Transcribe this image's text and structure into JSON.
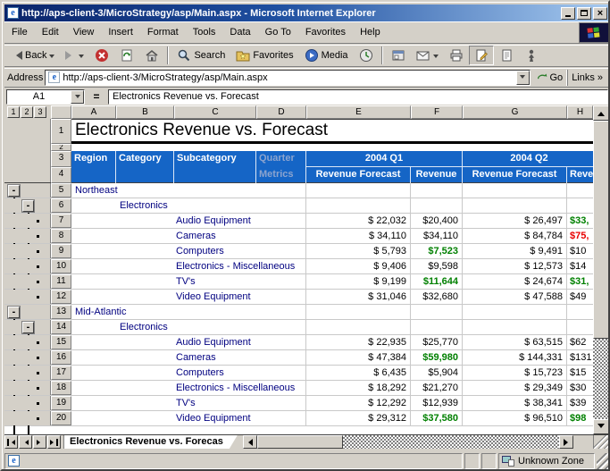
{
  "window": {
    "title": "http://aps-client-3/MicroStrategy/asp/Main.aspx - Microsoft Internet Explorer"
  },
  "menu_bar": {
    "items": [
      "File",
      "Edit",
      "View",
      "Insert",
      "Format",
      "Tools",
      "Data",
      "Go To",
      "Favorites",
      "Help"
    ]
  },
  "toolbar": {
    "back_label": "Back",
    "search_label": "Search",
    "favorites_label": "Favorites",
    "media_label": "Media"
  },
  "address_bar": {
    "label": "Address",
    "url": "http://aps-client-3/MicroStrategy/asp/Main.aspx",
    "go_label": "Go",
    "links_label": "Links",
    "links_chevron": "»"
  },
  "formula_bar": {
    "cell_ref": "A1",
    "equals_sign": "=",
    "value": "Electronics Revenue vs. Forecast"
  },
  "outline": {
    "level_buttons": [
      "1",
      "2",
      "3"
    ],
    "collapse_glyph": "-"
  },
  "grid": {
    "column_letters": [
      "A",
      "B",
      "C",
      "D",
      "E",
      "F",
      "G",
      "H"
    ],
    "row1": {
      "num": "1",
      "title": "Electronics Revenue vs. Forecast"
    },
    "row2_num": "2",
    "header": {
      "row3_num": "3",
      "row4_num": "4",
      "region": "Region",
      "category": "Category",
      "subcategory": "Subcategory",
      "quarter": "Quarter",
      "metrics": "Metrics",
      "q1": "2004 Q1",
      "q2": "2004 Q2",
      "forecast_label": "Revenue Forecast",
      "revenue_label": "Revenue",
      "revenue_label_clipped": "Reve"
    },
    "rows": [
      {
        "num": "5",
        "level": "region",
        "label": "Northeast",
        "e": "",
        "f": "",
        "fc": "k",
        "g": "",
        "h": "",
        "hc": "k"
      },
      {
        "num": "6",
        "level": "category",
        "label": "Electronics",
        "e": "",
        "f": "",
        "fc": "k",
        "g": "",
        "h": "",
        "hc": "k"
      },
      {
        "num": "7",
        "level": "sub",
        "label": "Audio Equipment",
        "e": "$ 22,032",
        "f": "$20,400",
        "fc": "k",
        "g": "$ 26,497",
        "h": "$33,",
        "hc": "g"
      },
      {
        "num": "8",
        "level": "sub",
        "label": "Cameras",
        "e": "$ 34,110",
        "f": "$34,110",
        "fc": "k",
        "g": "$ 84,784",
        "h": "$75,",
        "hc": "r"
      },
      {
        "num": "9",
        "level": "sub",
        "label": "Computers",
        "e": "$ 5,793",
        "f": "$7,523",
        "fc": "g",
        "g": "$ 9,491",
        "h": "$10",
        "hc": "k"
      },
      {
        "num": "10",
        "level": "sub",
        "label": "Electronics - Miscellaneous",
        "e": "$ 9,406",
        "f": "$9,598",
        "fc": "k",
        "g": "$ 12,573",
        "h": "$14",
        "hc": "k"
      },
      {
        "num": "11",
        "level": "sub",
        "label": "TV's",
        "e": "$ 9,199",
        "f": "$11,644",
        "fc": "g",
        "g": "$ 24,674",
        "h": "$31,",
        "hc": "g"
      },
      {
        "num": "12",
        "level": "sub",
        "label": "Video Equipment",
        "e": "$ 31,046",
        "f": "$32,680",
        "fc": "k",
        "g": "$ 47,588",
        "h": "$49",
        "hc": "k"
      },
      {
        "num": "13",
        "level": "region",
        "label": "Mid-Atlantic",
        "e": "",
        "f": "",
        "fc": "k",
        "g": "",
        "h": "",
        "hc": "k"
      },
      {
        "num": "14",
        "level": "category",
        "label": "Electronics",
        "e": "",
        "f": "",
        "fc": "k",
        "g": "",
        "h": "",
        "hc": "k"
      },
      {
        "num": "15",
        "level": "sub",
        "label": "Audio Equipment",
        "e": "$ 22,935",
        "f": "$25,770",
        "fc": "k",
        "g": "$ 63,515",
        "h": "$62",
        "hc": "k"
      },
      {
        "num": "16",
        "level": "sub",
        "label": "Cameras",
        "e": "$ 47,384",
        "f": "$59,980",
        "fc": "g",
        "g": "$ 144,331",
        "h": "$131",
        "hc": "k"
      },
      {
        "num": "17",
        "level": "sub",
        "label": "Computers",
        "e": "$ 6,435",
        "f": "$5,904",
        "fc": "k",
        "g": "$ 15,723",
        "h": "$15",
        "hc": "k"
      },
      {
        "num": "18",
        "level": "sub",
        "label": "Electronics - Miscellaneous",
        "e": "$ 18,292",
        "f": "$21,270",
        "fc": "k",
        "g": "$ 29,349",
        "h": "$30",
        "hc": "k"
      },
      {
        "num": "19",
        "level": "sub",
        "label": "TV's",
        "e": "$ 12,292",
        "f": "$12,939",
        "fc": "k",
        "g": "$ 38,341",
        "h": "$39",
        "hc": "k"
      },
      {
        "num": "20",
        "level": "sub",
        "label": "Video Equipment",
        "e": "$ 29,312",
        "f": "$37,580",
        "fc": "g",
        "g": "$ 96,510",
        "h": "$98",
        "hc": "g"
      }
    ]
  },
  "sheet_bar": {
    "tab_label": "Electronics Revenue vs. Forecas"
  },
  "status_bar": {
    "zone_label": "Unknown Zone"
  },
  "colors": {
    "header_blue": "#1565C6",
    "header_dim_text": "#8CA4CF",
    "link_navy": "#000080",
    "positive_green": "#008000",
    "negative_red": "#E80000"
  }
}
